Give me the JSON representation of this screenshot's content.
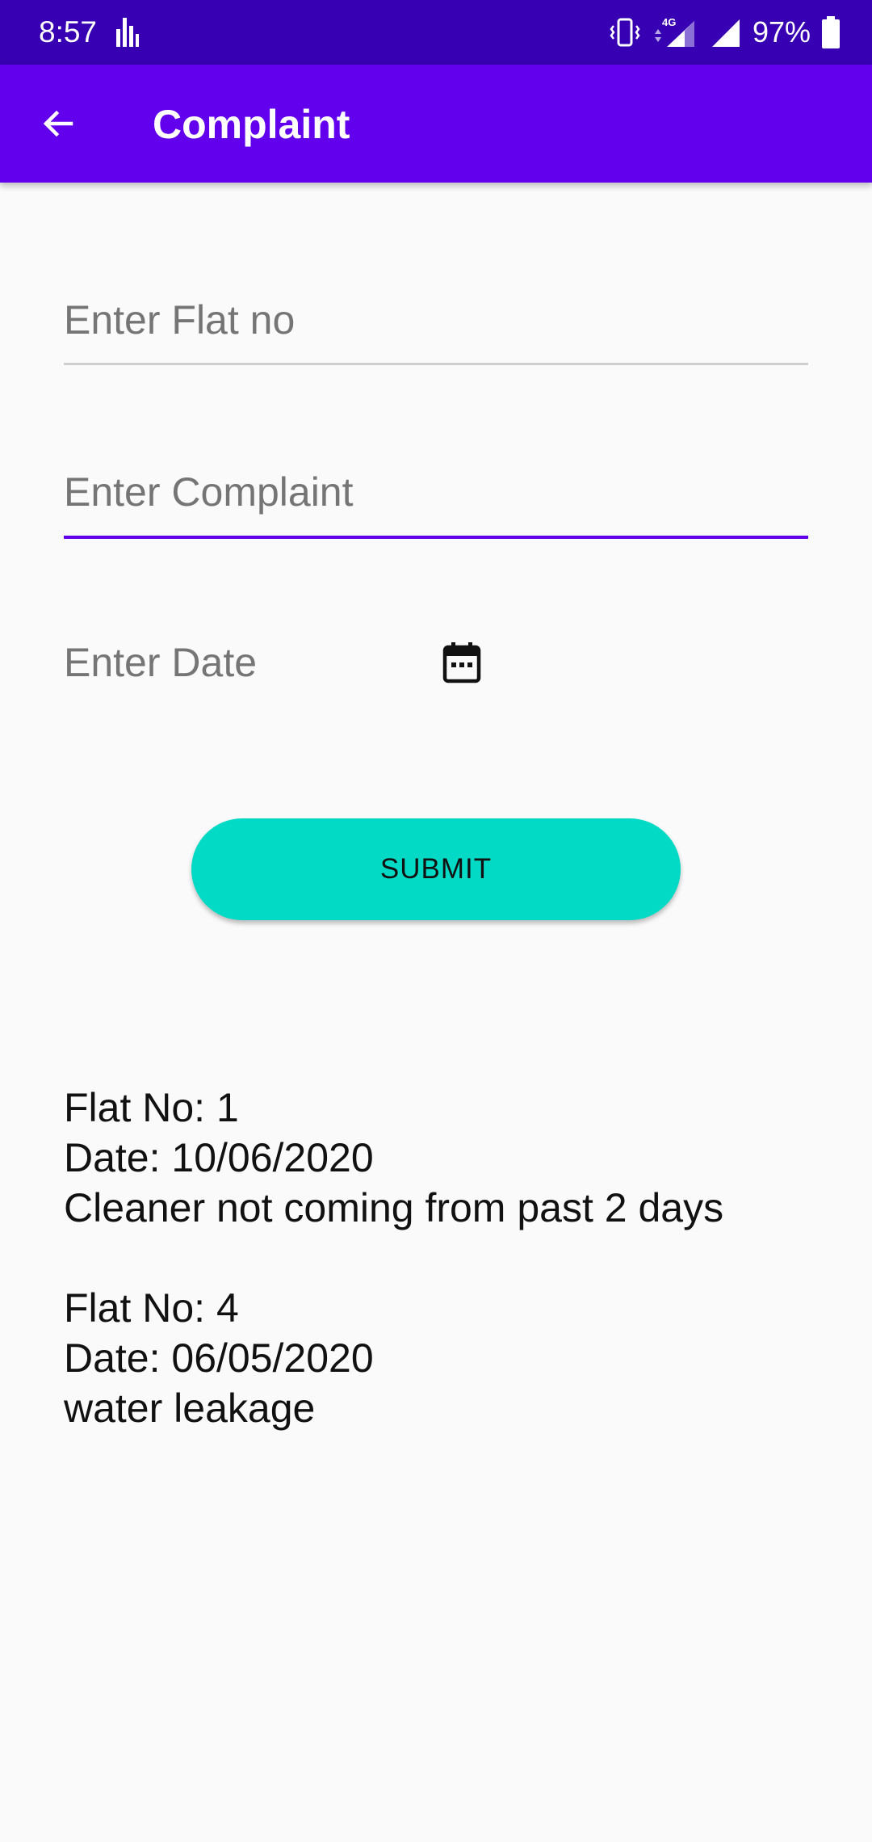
{
  "status_bar": {
    "time": "8:57",
    "network": "4G",
    "battery": "97%"
  },
  "app_bar": {
    "title": "Complaint",
    "back_icon": "arrow-back-icon",
    "background": "#6200ee"
  },
  "form": {
    "flat_placeholder": "Enter Flat no",
    "complaint_placeholder": "Enter Complaint",
    "date_placeholder": "Enter Date",
    "date_icon": "calendar-icon",
    "submit_label": "SUBMIT",
    "accent_color": "#03dac5"
  },
  "complaints": [
    {
      "flat": "Flat No: 1",
      "date": "Date: 10/06/2020",
      "text": "Cleaner not coming from past 2 days"
    },
    {
      "flat": "Flat No: 4",
      "date": "Date: 06/05/2020",
      "text": "water leakage"
    }
  ]
}
